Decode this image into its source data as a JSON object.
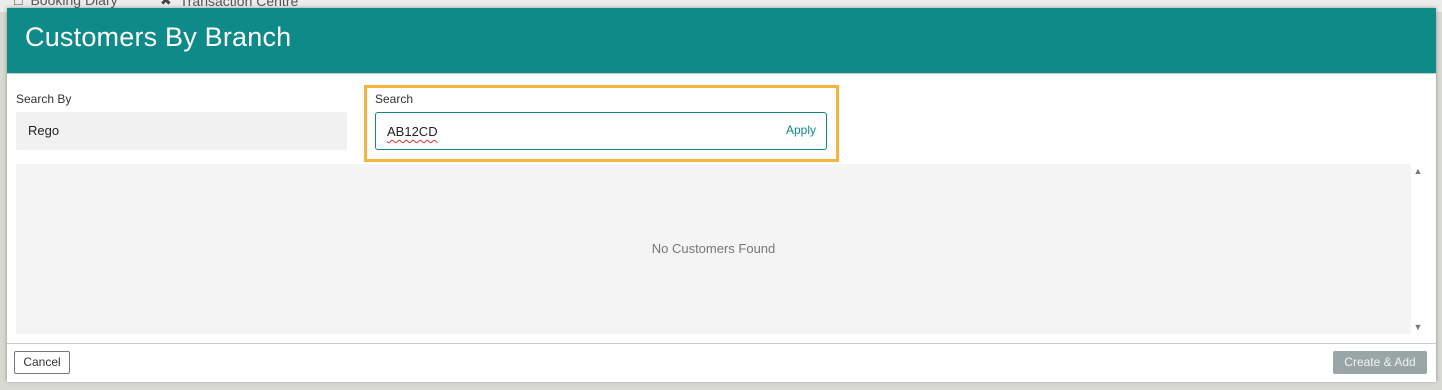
{
  "background": {
    "tabs": [
      {
        "label": "Booking Diary",
        "icon": "calendar-icon"
      },
      {
        "label": "Transaction Centre",
        "icon": "tools-icon"
      }
    ]
  },
  "modal": {
    "title": "Customers By Branch",
    "search_by": {
      "label": "Search By",
      "value": "Rego"
    },
    "search": {
      "label": "Search",
      "value": "AB12CD",
      "apply_label": "Apply"
    },
    "results": {
      "empty_message": "No Customers Found"
    },
    "footer": {
      "cancel_label": "Cancel",
      "create_label": "Create & Add"
    }
  },
  "colors": {
    "header": "#0e8a89",
    "highlight": "#f4b63f",
    "accent": "#0e8a89",
    "disabled_button": "#9aa6a6"
  }
}
